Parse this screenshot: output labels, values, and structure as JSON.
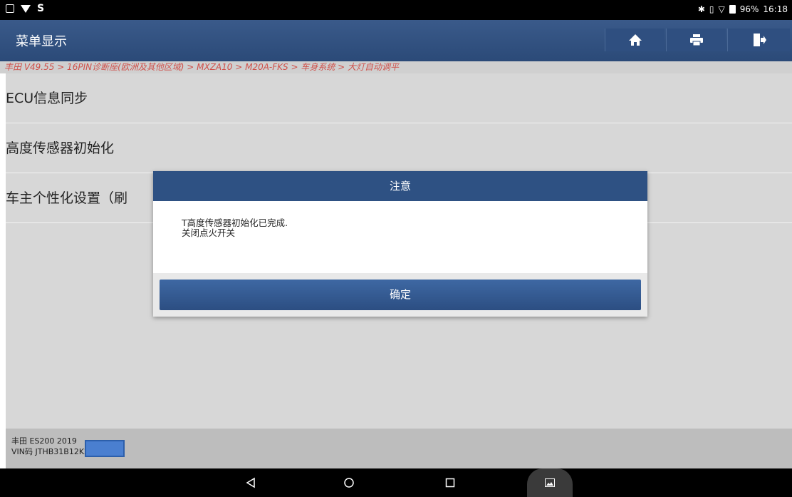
{
  "status_bar": {
    "time": "16:18",
    "battery": "96%"
  },
  "header": {
    "title": "菜单显示",
    "home_icon": "home-icon",
    "print_icon": "print-icon",
    "exit_icon": "exit-icon"
  },
  "breadcrumb": "丰田 V49.55 > 16PIN诊断座(欧洲及其他区域) > MXZA10 > M20A-FKS > 车身系统 > 大灯自动调平",
  "menu": {
    "items": [
      {
        "label": "ECU信息同步"
      },
      {
        "label": "高度传感器初始化"
      },
      {
        "label": "车主个性化设置（刷"
      }
    ]
  },
  "footer": {
    "vehicle": "丰田 ES200 2019",
    "vin": "VIN码 JTHB31B12K2"
  },
  "dialog": {
    "title": "注意",
    "lines": [
      "T高度传感器初始化已完成.",
      "关闭点火开关"
    ],
    "ok_label": "确定"
  },
  "colors": {
    "title_bar": "#2b4a78",
    "dialog_header": "#2e5183",
    "breadcrumb_text": "#d0504a"
  }
}
